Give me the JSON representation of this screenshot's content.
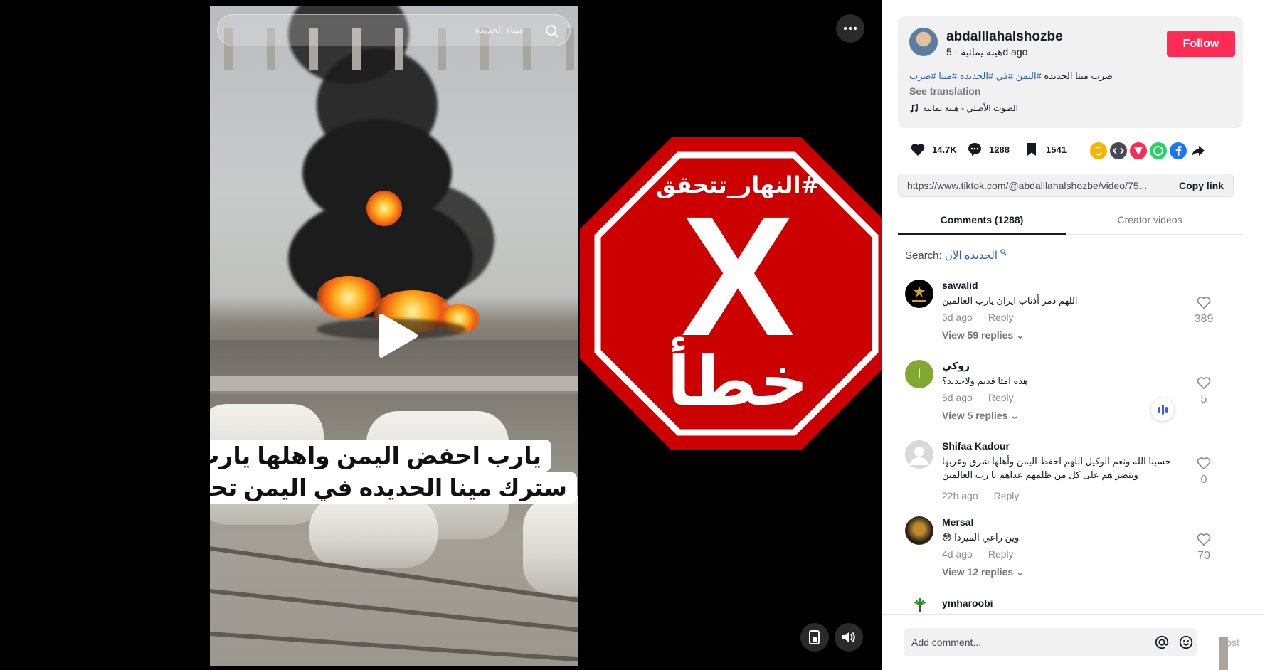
{
  "video": {
    "search_text": "ميناء الحديدة",
    "caption_line1": "يارب احفض اليمن واهلها يارب",
    "caption_line2": "سترك مينا الحديده في اليمن تحترق"
  },
  "overlay": {
    "hashtag": "#النهار_تتحقق",
    "mark": "X",
    "verdict": "خطأ",
    "color": "#cc0000"
  },
  "post": {
    "author": "abdalllahalshozbe",
    "nickname": "هيبه يمانيه",
    "time": "5d ago",
    "follow_label": "Follow",
    "description_tags": "#اليمن #في #الحديده #مينا #ضرب",
    "description_text": "ضرب مينا الحديده",
    "see_translation": "See translation",
    "music": "الصوت الأصلي - هيبه يمانيه",
    "likes": "14.7K",
    "comments_count": "1288",
    "saves": "1541",
    "link": "https://www.tiktok.com/@abdalllahalshozbe/video/75...",
    "copy_link": "Copy link",
    "accent": "#fe2c55"
  },
  "tabs": [
    "Comments (1288)",
    "Creator videos"
  ],
  "comment_search": {
    "label": "Search:",
    "query": "الحديده الآن"
  },
  "comments": [
    {
      "user": "sawalid",
      "text": "اللهم دمر أذناب ايران يارب العالمين",
      "time": "5d ago",
      "reply": "Reply",
      "replies": "View 59 replies",
      "likes": "389"
    },
    {
      "user": "روكي",
      "text": "هذه امتا قديم ولاجديد؟",
      "time": "5d ago",
      "reply": "Reply",
      "replies": "View 5 replies",
      "likes": "5"
    },
    {
      "user": "Shifaa Kadour",
      "text": "حسبنا الله ونعم الوكيل اللهم احفظ اليمن وأهلها شرق وعربها وينصر هم على كل من ظلمهم عداهم يا رب العالمين",
      "time": "22h ago",
      "reply": "Reply",
      "replies": "",
      "likes": "0"
    },
    {
      "user": "Mersal",
      "text": "وين راعي الميردا 😳",
      "time": "4d ago",
      "reply": "Reply",
      "replies": "View 12 replies",
      "likes": "70"
    },
    {
      "user": "ymharoobi",
      "text": "",
      "time": "",
      "reply": "",
      "replies": "",
      "likes": ""
    }
  ],
  "footer": {
    "placeholder": "Add comment...",
    "post_label": "Post"
  }
}
